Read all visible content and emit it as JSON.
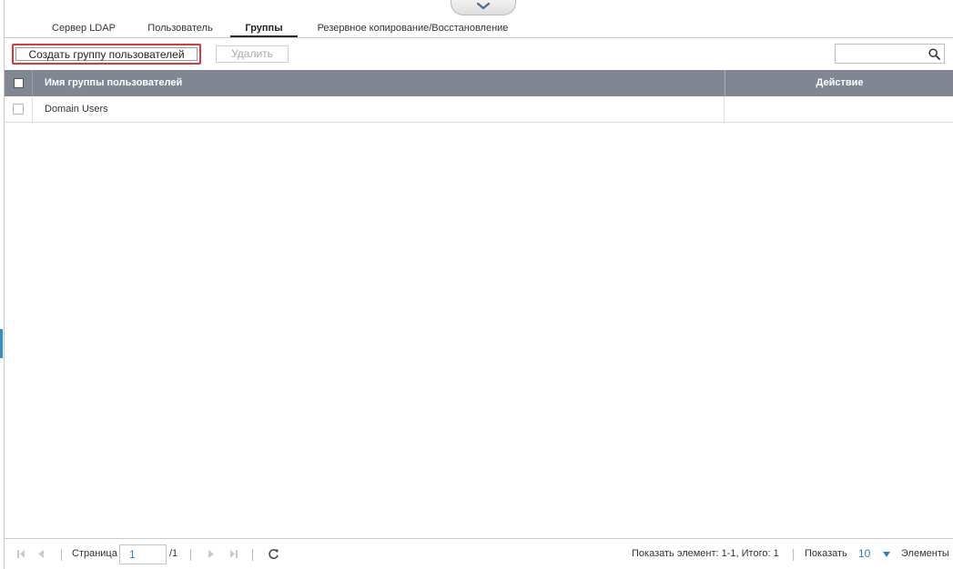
{
  "tabs": [
    {
      "label": "Сервер LDAP",
      "active": false
    },
    {
      "label": "Пользователь",
      "active": false
    },
    {
      "label": "Группы",
      "active": true
    },
    {
      "label": "Резервное копирование/Восстановление",
      "active": false
    }
  ],
  "toolbar": {
    "create_label": "Создать группу пользователей",
    "delete_label": "Удалить",
    "search_value": "",
    "search_icon": "search-icon"
  },
  "grid": {
    "columns": [
      "Имя группы пользователей",
      "Действие"
    ],
    "rows": [
      {
        "name": "Domain Users",
        "checked": false
      }
    ]
  },
  "pagination": {
    "page_label": "Страница",
    "current_page": "1",
    "total_pages": "/1",
    "summary": "Показать элемент: 1-1, Итого: 1",
    "show_label": "Показать",
    "per_page": "10",
    "items_label": "Элементы"
  },
  "colors": {
    "header_bg": "#808793",
    "highlight_border": "#e0363a",
    "accent_blue": "#2d7cc1"
  }
}
